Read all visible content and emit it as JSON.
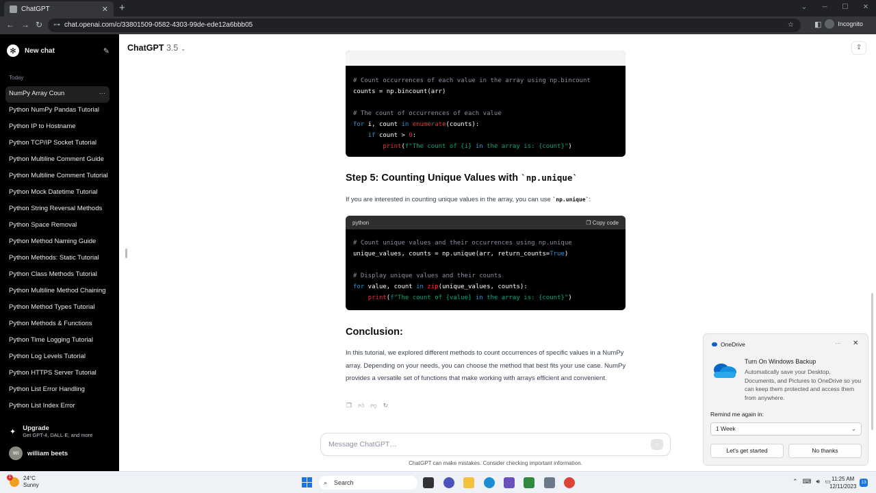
{
  "browser": {
    "tab_title": "ChatGPT",
    "url": "chat.openai.com/c/33801509-0582-4303-99de-ede12a6bbb05",
    "incognito_label": "Incognito"
  },
  "sidebar": {
    "new_chat": "New chat",
    "section": "Today",
    "items": [
      {
        "label": "NumPy Array Coun",
        "active": true
      },
      {
        "label": "Python NumPy Pandas Tutorial"
      },
      {
        "label": "Python IP to Hostname"
      },
      {
        "label": "Python TCP/IP Socket Tutorial"
      },
      {
        "label": "Python Multiline Comment Guide"
      },
      {
        "label": "Python Multiline Comment Tutorial"
      },
      {
        "label": "Python Mock Datetime Tutorial"
      },
      {
        "label": "Python String Reversal Methods"
      },
      {
        "label": "Python Space Removal"
      },
      {
        "label": "Python Method Naming Guide"
      },
      {
        "label": "Python Methods: Static Tutorial"
      },
      {
        "label": "Python Class Methods Tutorial"
      },
      {
        "label": "Python Multiline Method Chaining"
      },
      {
        "label": "Python Method Types Tutorial"
      },
      {
        "label": "Python Methods & Functions"
      },
      {
        "label": "Python Time Logging Tutorial"
      },
      {
        "label": "Python Log Levels Tutorial"
      },
      {
        "label": "Python HTTPS Server Tutorial"
      },
      {
        "label": "Python List Error Handling"
      },
      {
        "label": "Python List Index Error"
      }
    ],
    "upgrade_title": "Upgrade",
    "upgrade_sub": "Get GPT-4, DALL·E, and more",
    "user_initials": "WI",
    "user_name": "william beets"
  },
  "header": {
    "model": "ChatGPT",
    "version": "3.5"
  },
  "content": {
    "code1": {
      "lines": [
        "# Count occurrences of each value in the array using np.bincount",
        "counts = np.bincount(arr)",
        "",
        "# The count of occurrences of each value",
        "for i, count in enumerate(counts):",
        "    if count > 0:",
        "        print(f\"The count of {i} in the array is: {count}\")"
      ]
    },
    "step5_heading": "Step 5: Counting Unique Values with",
    "step5_code": "`np.unique`",
    "step5_para_before": "If you are interested in counting unique values in the array, you can use ",
    "step5_para_code": "`np.unique`",
    "step5_para_after": ":",
    "code2": {
      "lang": "python",
      "copy": "Copy code",
      "lines": [
        "# Count unique values and their occurrences using np.unique",
        "unique_values, counts = np.unique(arr, return_counts=True)",
        "",
        "# Display unique values and their counts",
        "for value, count in zip(unique_values, counts):",
        "    print(f\"The count of {value} in the array is: {count}\")"
      ]
    },
    "conclusion_heading": "Conclusion:",
    "conclusion_text": "In this tutorial, we explored different methods to count occurrences of specific values in a NumPy array. Depending on your needs, you can choose the method that best fits your use case. NumPy provides a versatile set of functions that make working with arrays efficient and convenient."
  },
  "composer": {
    "placeholder": "Message ChatGPT…",
    "disclaimer": "ChatGPT can make mistakes. Consider checking important information."
  },
  "toast": {
    "app": "OneDrive",
    "title": "Turn On Windows Backup",
    "body": "Automatically save your Desktop, Documents, and Pictures to OneDrive so you can keep them protected and access them from anywhere.",
    "remind_label": "Remind me again in:",
    "remind_value": "1 Week",
    "primary": "Let's get started",
    "secondary": "No thanks"
  },
  "taskbar": {
    "temp": "24°C",
    "weather": "Sunny",
    "weather_badge": "1",
    "search": "Search",
    "time": "11:25 AM",
    "date": "12/11/2023",
    "notif_count": "13"
  },
  "colors": {
    "sidebar_bg": "#000000",
    "code_bg": "#000000",
    "accent": "#10a37f"
  }
}
